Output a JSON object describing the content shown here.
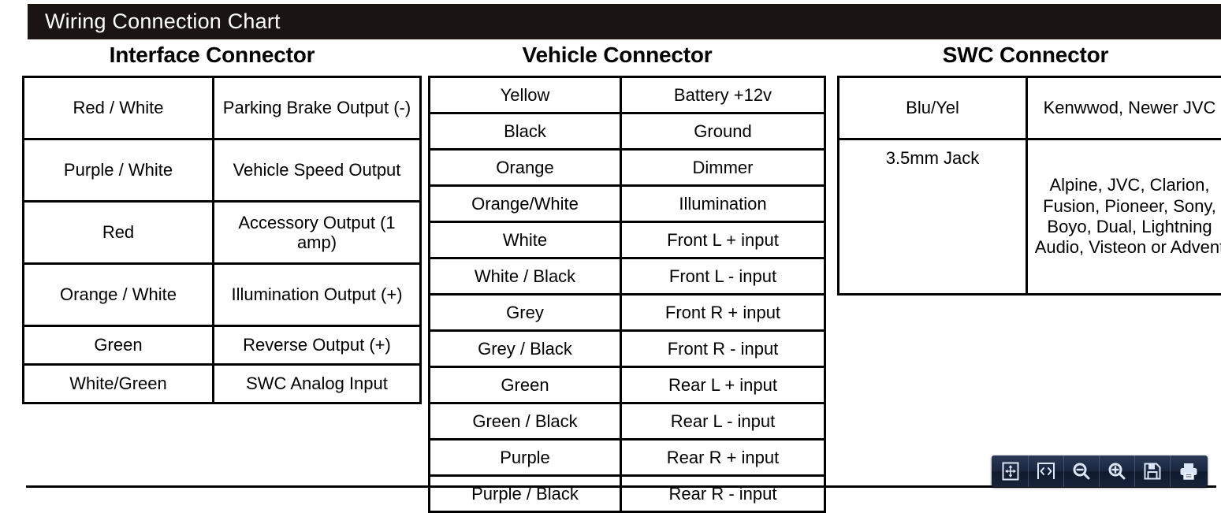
{
  "header": {
    "title": "Wiring Connection Chart",
    "bar_color": "#1a1512",
    "text_color": "#ffffff"
  },
  "sections": [
    {
      "id": "interface",
      "heading": "Interface Connector",
      "rows": [
        {
          "wire": "Red / White",
          "function": "Parking Brake Output (-)"
        },
        {
          "wire": "Purple / White",
          "function": "Vehicle Speed Output"
        },
        {
          "wire": "Red",
          "function": "Accessory Output (1 amp)"
        },
        {
          "wire": "Orange / White",
          "function": "Illumination Output (+)"
        },
        {
          "wire": "Green",
          "function": "Reverse Output (+)"
        },
        {
          "wire": "White/Green",
          "function": "SWC Analog Input"
        }
      ]
    },
    {
      "id": "vehicle",
      "heading": "Vehicle Connector",
      "rows": [
        {
          "wire": "Yellow",
          "function": "Battery +12v"
        },
        {
          "wire": "Black",
          "function": "Ground"
        },
        {
          "wire": "Orange",
          "function": "Dimmer"
        },
        {
          "wire": "Orange/White",
          "function": "Illumination"
        },
        {
          "wire": "White",
          "function": "Front L + input"
        },
        {
          "wire": "White / Black",
          "function": "Front L - input"
        },
        {
          "wire": "Grey",
          "function": "Front R + input"
        },
        {
          "wire": "Grey / Black",
          "function": "Front R - input"
        },
        {
          "wire": "Green",
          "function": "Rear L + input"
        },
        {
          "wire": "Green / Black",
          "function": "Rear L - input"
        },
        {
          "wire": "Purple",
          "function": "Rear R + input"
        },
        {
          "wire": "Purple / Black",
          "function": "Rear R - input"
        }
      ]
    },
    {
      "id": "swc",
      "heading": "SWC Connector",
      "rows": [
        {
          "wire": "Blu/Yel",
          "function": "Kenwwod, Newer JVC"
        },
        {
          "wire": "3.5mm Jack",
          "function": "Alpine, JVC, Clarion, Fusion, Pioneer, Sony, Boyo, Dual, Lightning Audio, Visteon or Advent"
        }
      ]
    }
  ],
  "toolbar": {
    "buttons": [
      {
        "icon": "fit-page-icon",
        "label": "Fit Page"
      },
      {
        "icon": "fit-width-icon",
        "label": "Fit Width"
      },
      {
        "icon": "zoom-out-icon",
        "label": "Zoom Out"
      },
      {
        "icon": "zoom-in-icon",
        "label": "Zoom In"
      },
      {
        "icon": "save-icon",
        "label": "Save"
      },
      {
        "icon": "print-icon",
        "label": "Print"
      }
    ]
  }
}
